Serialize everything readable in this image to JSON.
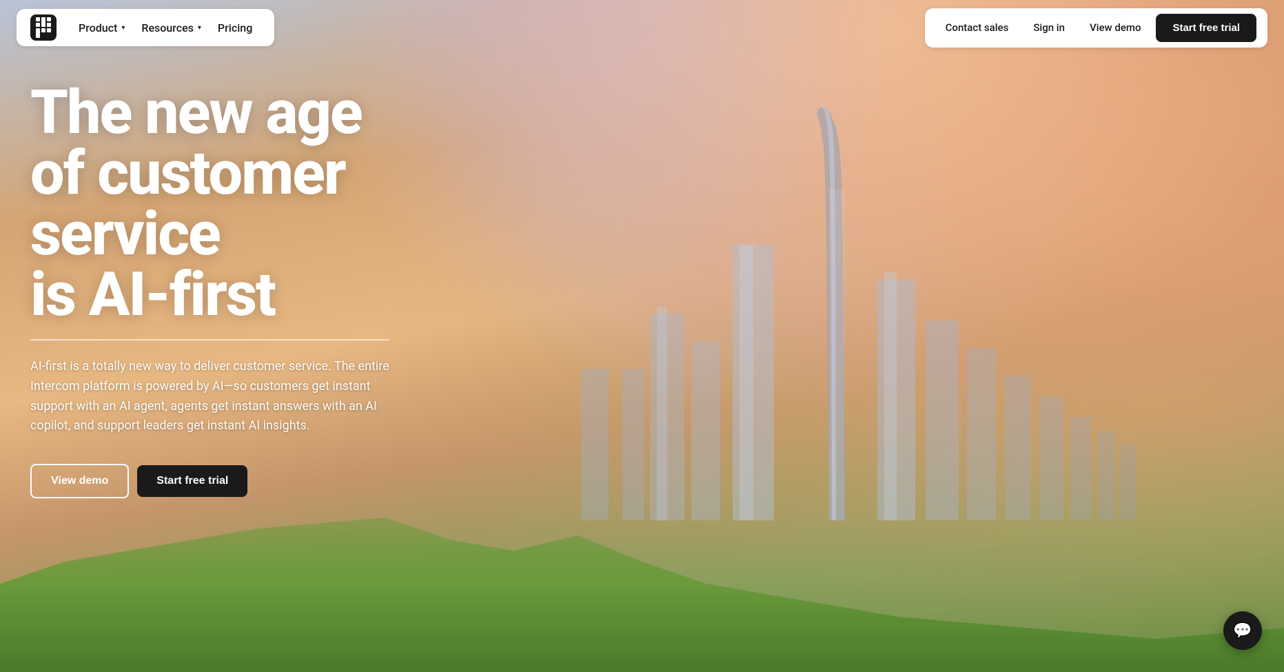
{
  "navbar": {
    "logo_alt": "Intercom logo",
    "nav_left": {
      "product_label": "Product",
      "resources_label": "Resources",
      "pricing_label": "Pricing"
    },
    "nav_right": {
      "contact_sales_label": "Contact sales",
      "sign_in_label": "Sign in",
      "view_demo_label": "View demo",
      "start_trial_label": "Start free trial"
    }
  },
  "hero": {
    "title_line1": "The new age",
    "title_line2": "of customer service",
    "title_line3": "is AI-first",
    "description": "AI-first is a totally new way to deliver customer service. The entire Intercom platform is powered by AI—so customers get instant support with an AI agent, agents get instant answers with an AI copilot, and support leaders get instant AI insights.",
    "view_demo_label": "View demo",
    "start_trial_label": "Start free trial"
  },
  "chat": {
    "icon": "💬"
  }
}
